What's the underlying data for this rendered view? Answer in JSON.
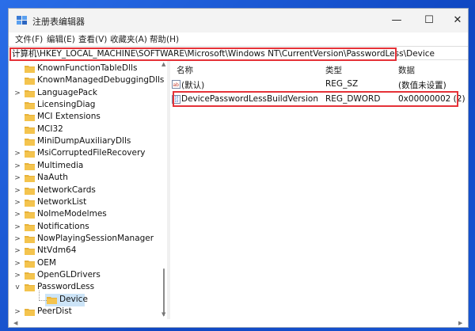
{
  "window": {
    "title": "注册表编辑器",
    "controls": {
      "minimize": "—",
      "maximize": "☐",
      "close": "✕"
    }
  },
  "menu": [
    "文件(F)",
    "编辑(E)",
    "查看(V)",
    "收藏夹(A)",
    "帮助(H)"
  ],
  "address": "计算机\\HKEY_LOCAL_MACHINE\\SOFTWARE\\Microsoft\\Windows NT\\CurrentVersion\\PasswordLess\\Device",
  "tree": {
    "items": [
      {
        "label": "KnownFunctionTableDlls",
        "expander": ""
      },
      {
        "label": "KnownManagedDebuggingDlls",
        "expander": ""
      },
      {
        "label": "LanguagePack",
        "expander": ">"
      },
      {
        "label": "LicensingDiag",
        "expander": ""
      },
      {
        "label": "MCI Extensions",
        "expander": ""
      },
      {
        "label": "MCI32",
        "expander": ""
      },
      {
        "label": "MiniDumpAuxiliaryDlls",
        "expander": ""
      },
      {
        "label": "MsiCorruptedFileRecovery",
        "expander": ">"
      },
      {
        "label": "Multimedia",
        "expander": ">"
      },
      {
        "label": "NaAuth",
        "expander": ">"
      },
      {
        "label": "NetworkCards",
        "expander": ">"
      },
      {
        "label": "NetworkList",
        "expander": ">"
      },
      {
        "label": "NoImeModelmes",
        "expander": ">"
      },
      {
        "label": "Notifications",
        "expander": ">"
      },
      {
        "label": "NowPlayingSessionManager",
        "expander": ">"
      },
      {
        "label": "NtVdm64",
        "expander": ">"
      },
      {
        "label": "OEM",
        "expander": ">"
      },
      {
        "label": "OpenGLDrivers",
        "expander": ">"
      },
      {
        "label": "PasswordLess",
        "expander": "v"
      },
      {
        "label": "Device",
        "expander": ""
      },
      {
        "label": "PeerDist",
        "expander": ">"
      }
    ]
  },
  "list": {
    "headers": {
      "name": "名称",
      "type": "类型",
      "data": "数据"
    },
    "rows": [
      {
        "name": "(默认)",
        "type": "REG_SZ",
        "data": "(数值未设置)",
        "icon": "reg-sz-icon"
      },
      {
        "name": "DevicePasswordLessBuildVersion",
        "type": "REG_DWORD",
        "data": "0x00000002 (2)",
        "icon": "reg-dword-icon"
      }
    ]
  },
  "colors": {
    "highlight": "#e53238",
    "selection": "#cce4f7",
    "folder": "#f4c44e",
    "desktop": "#1d5bd6"
  }
}
